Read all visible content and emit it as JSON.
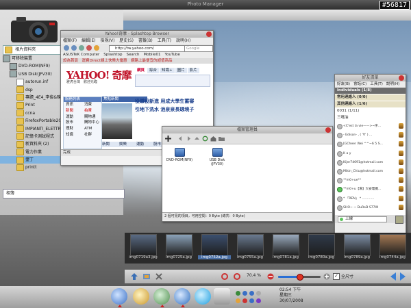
{
  "app": {
    "title": "Photo Manager",
    "badge": "#56817"
  },
  "left_panel": {
    "albums_label": "相片資料夾",
    "tree": [
      {
        "label": "可移除裝置",
        "icon": "drive-icon",
        "indent": 0,
        "type": "drive"
      },
      {
        "label": "DVD-ROM(NF9)",
        "icon": "dvd-icon",
        "indent": 1,
        "type": "drive"
      },
      {
        "label": "USB Disk(JFV30)",
        "icon": "usb-disk-icon",
        "indent": 1,
        "type": "drive"
      },
      {
        "label": "autorun.inf",
        "icon": "file-icon",
        "indent": 2,
        "type": "file"
      },
      {
        "label": "dsp",
        "icon": "folder-icon",
        "indent": 2,
        "type": "folder"
      },
      {
        "label": "專題_4E4_李俊&陳亞",
        "icon": "folder-icon",
        "indent": 2,
        "type": "folder"
      },
      {
        "label": "Print",
        "icon": "folder-icon",
        "indent": 2,
        "type": "folder"
      },
      {
        "label": "ccna",
        "icon": "folder-icon",
        "indent": 2,
        "type": "folder"
      },
      {
        "label": "FirefoxPortable20",
        "icon": "folder-icon",
        "indent": 2,
        "type": "folder"
      },
      {
        "label": "IMPIANTI_ELETTRICI",
        "icon": "folder-icon",
        "indent": 2,
        "type": "folder"
      },
      {
        "label": "記憶卡測試程式",
        "icon": "folder-icon",
        "indent": 2,
        "type": "folder"
      },
      {
        "label": "新資料夾 (2)",
        "icon": "folder-icon",
        "indent": 2,
        "type": "folder"
      },
      {
        "label": "電力作業",
        "icon": "folder-icon",
        "indent": 2,
        "type": "folder"
      },
      {
        "label": "墾丁",
        "icon": "folder-icon",
        "indent": 2,
        "type": "folder",
        "selected": true
      },
      {
        "label": "printt",
        "icon": "folder-icon",
        "indent": 2,
        "type": "folder"
      }
    ],
    "bottom_label": "相簿"
  },
  "browser": {
    "title": "Yahoo!奇摩 - Splashtop Browser",
    "menu": [
      "檔案(F)",
      "編輯(E)",
      "檢視(V)",
      "歷史(S)",
      "書籤(B)",
      "工具(T)",
      "說明(H)"
    ],
    "url": "http://tw.yahoo.com/",
    "search_placeholder": "Google",
    "bookmarks": [
      "ASUSTeK Computer",
      "Splashtop",
      "Search",
      "Mobile01",
      "YouTube"
    ],
    "notice": "設為首頁　運費Direct線上快樂大優惠　網路上最便宜的超值商品",
    "logo": "YAHOO! 奇摩",
    "logo_sub": "雅虎台灣　歡迎光臨",
    "tabs": [
      "網頁",
      "綜合",
      "知識+",
      "圖片",
      "影片"
    ],
    "left_header": "服務列表",
    "left_items": [
      "資訊",
      "新聞",
      "運動",
      "股市",
      "理財",
      "知識"
    ],
    "left_items2": [
      "消費",
      "拍賣",
      "購物通",
      "購物中心",
      "ATM",
      "社群"
    ],
    "news_header": "焦點新聞",
    "headlines": [
      "役職役新進  用成大學生蓄審",
      "引地下洗水  池泉泉長環境子"
    ],
    "bottom_nav": [
      "新聞",
      "娛樂",
      "運動",
      "股市",
      "國際"
    ],
    "status": "完成"
  },
  "disk_manager": {
    "title": "檔案管理員",
    "disks": [
      {
        "label": "DVD-ROM(NF9)"
      },
      {
        "label": "USB Disk\n(JFV30)"
      }
    ],
    "status": "2 個可見的項目，可用空間：0 Byte (總共：0 Byte)"
  },
  "chat": {
    "title": "好友清單",
    "menu": [
      "好友(B)",
      "會話(C)",
      "工具(T)",
      "說明(H)"
    ],
    "groups": [
      {
        "label": "Individuals (1/8)",
        "highlight": true
      },
      {
        "label": "常用連絡人 (0/0)",
        "highlight": false
      },
      {
        "label": "其他連絡人 (1/6)",
        "highlight": false
      },
      {
        "label": "0031 (1/11)",
        "highlight": false,
        "sub": true
      },
      {
        "label": "三嘴油",
        "highlight": false,
        "sub": true
      }
    ],
    "contacts": [
      {
        "name": "<C'est la vie——>~序...",
        "online": false
      },
      {
        "name": "- Edison- , ( '∀' ) ...",
        "online": false
      },
      {
        "name": "[GCheer Wei ^^~6 5 S...",
        "online": false
      },
      {
        "name": "K a y",
        "online": false
      },
      {
        "name": "Kijer74091@hotmail.com",
        "online": false
      },
      {
        "name": "Mikin_Chiu@hotmail.com",
        "online": false
      },
      {
        "name": "**m0+ue**",
        "online": false
      },
      {
        "name": "**m0+u【琳】大安電機...",
        "online": true
      },
      {
        "name": "* 「REN」 * ............",
        "online": false
      },
      {
        "name": "SHO~ ~ DuRoD S77W",
        "online": false
      }
    ],
    "status_label": "上線"
  },
  "thumbnails": [
    {
      "label": "img0719a3.jpg",
      "color": "#5a6b84"
    },
    {
      "label": "img0725a.jpg",
      "color": "#8ba2b9"
    },
    {
      "label": "img0752a.jpg",
      "color": "#3b4f6e",
      "selected": true
    },
    {
      "label": "img0755a.jpg",
      "color": "#6a7a90"
    },
    {
      "label": "img0781a.jpg",
      "color": "#9aaabd"
    },
    {
      "label": "img0780a.jpg",
      "color": "#2f3a4a"
    },
    {
      "label": "img0789a.jpg",
      "color": "#7e8fa6"
    },
    {
      "label": "img0744a.jpg",
      "color": "#a47854"
    }
  ],
  "controls": {
    "zoom_label": "70.4 %",
    "zoom_percent": 50,
    "fullsize_label": "全尺寸",
    "fullsize_checked": true
  },
  "taskbar": {
    "clock_time": "02:54 下午",
    "clock_day": "星期三",
    "clock_date": "30/07/2008"
  },
  "colors": {
    "accent": "#2a6fd5",
    "selected_row": "#7fb3e0",
    "yahoo_red": "#c0142a"
  }
}
